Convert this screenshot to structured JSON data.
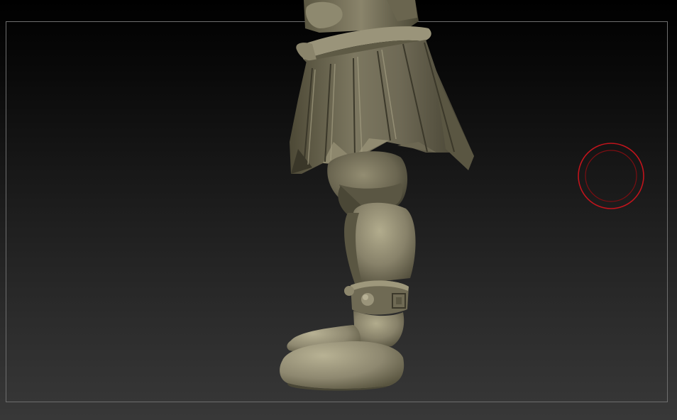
{
  "app": {
    "name": ""
  },
  "viewport": {
    "background_top": "#000000",
    "background_bottom": "#383838",
    "frame_color": "#6e6e6e"
  },
  "model": {
    "material_color": "#7d7860",
    "highlight_color": "#b3ad8c",
    "shadow_color": "#3a3729",
    "subject": "sculpted-character-lower-body"
  },
  "brush": {
    "outer_color": "#c0141c",
    "inner_color": "#7a0e12",
    "icon": "brush-circle-cursor"
  }
}
